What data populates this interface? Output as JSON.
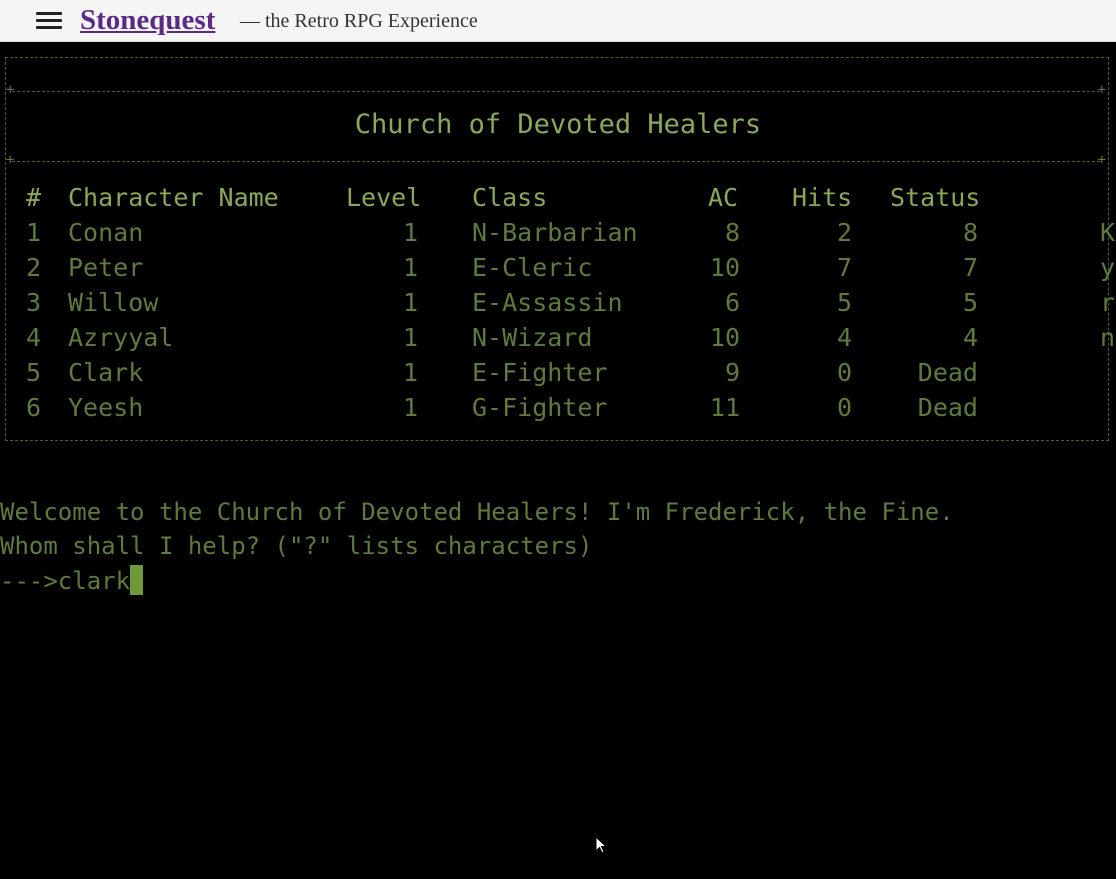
{
  "header": {
    "site_title": "Stonequest",
    "tagline": "— the Retro RPG Experience"
  },
  "game": {
    "location_title": "Church of Devoted Healers",
    "columns": [
      "#",
      "Character Name",
      "Level",
      "Class",
      "AC",
      "Hits",
      "Status"
    ],
    "characters": [
      {
        "num": "1",
        "name": "Conan",
        "level": "1",
        "class": "N-Barbarian",
        "ac": "8",
        "hits": "2",
        "status": "8",
        "extra": "K"
      },
      {
        "num": "2",
        "name": "Peter",
        "level": "1",
        "class": "E-Cleric",
        "ac": "10",
        "hits": "7",
        "status": "7",
        "extra": "y"
      },
      {
        "num": "3",
        "name": "Willow",
        "level": "1",
        "class": "E-Assassin",
        "ac": "6",
        "hits": "5",
        "status": "5",
        "extra": "r"
      },
      {
        "num": "4",
        "name": "Azryyal",
        "level": "1",
        "class": "N-Wizard",
        "ac": "10",
        "hits": "4",
        "status": "4",
        "extra": "n"
      },
      {
        "num": "5",
        "name": "Clark",
        "level": "1",
        "class": "E-Fighter",
        "ac": "9",
        "hits": "0",
        "status": "Dead",
        "extra": ""
      },
      {
        "num": "6",
        "name": "Yeesh",
        "level": "1",
        "class": "G-Fighter",
        "ac": "11",
        "hits": "0",
        "status": "Dead",
        "extra": ""
      }
    ],
    "messages": [
      "Welcome to the Church of Devoted Healers! I'm Frederick, the Fine.",
      "Whom shall I help? (\"?\" lists characters)"
    ],
    "prompt": "--->",
    "input_value": "clark"
  }
}
